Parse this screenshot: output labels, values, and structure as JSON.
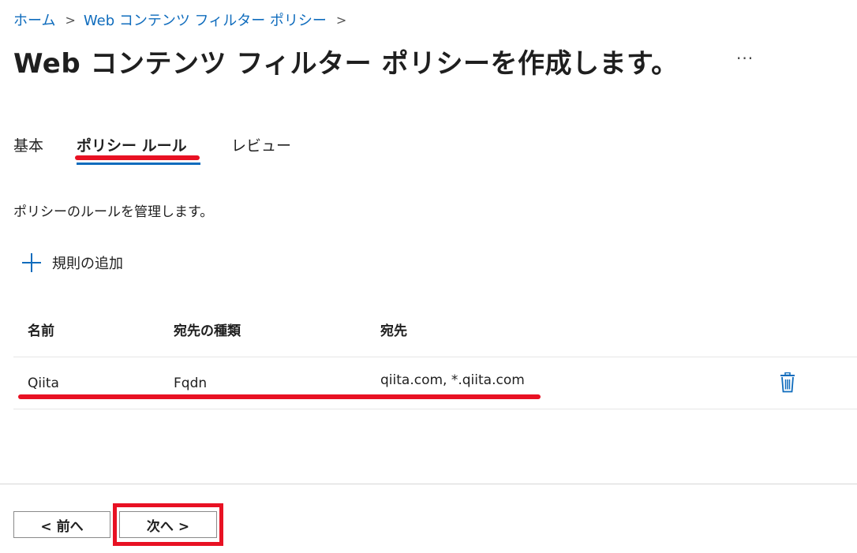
{
  "breadcrumb": {
    "items": [
      "ホーム",
      "Web コンテンツ フィルター ポリシー"
    ],
    "separator": ">"
  },
  "page": {
    "title": "Web コンテンツ フィルター ポリシーを作成します。",
    "more_label": "···"
  },
  "tabs": [
    {
      "label": "基本",
      "active": false
    },
    {
      "label": "ポリシー ルール",
      "active": true
    },
    {
      "label": "レビュー",
      "active": false
    }
  ],
  "rules": {
    "description": "ポリシーのルールを管理します。",
    "add_label": "規則の追加",
    "columns": [
      "名前",
      "宛先の種類",
      "宛先"
    ],
    "rows": [
      {
        "name": "Qiita",
        "type": "Fqdn",
        "destination": "qiita.com, *.qiita.com",
        "delete_icon": "trash-icon"
      }
    ]
  },
  "footer": {
    "prev_label": "< 前へ",
    "next_label": "次へ >"
  },
  "colors": {
    "accent": "#0f6cbd",
    "highlight": "#e81123"
  }
}
